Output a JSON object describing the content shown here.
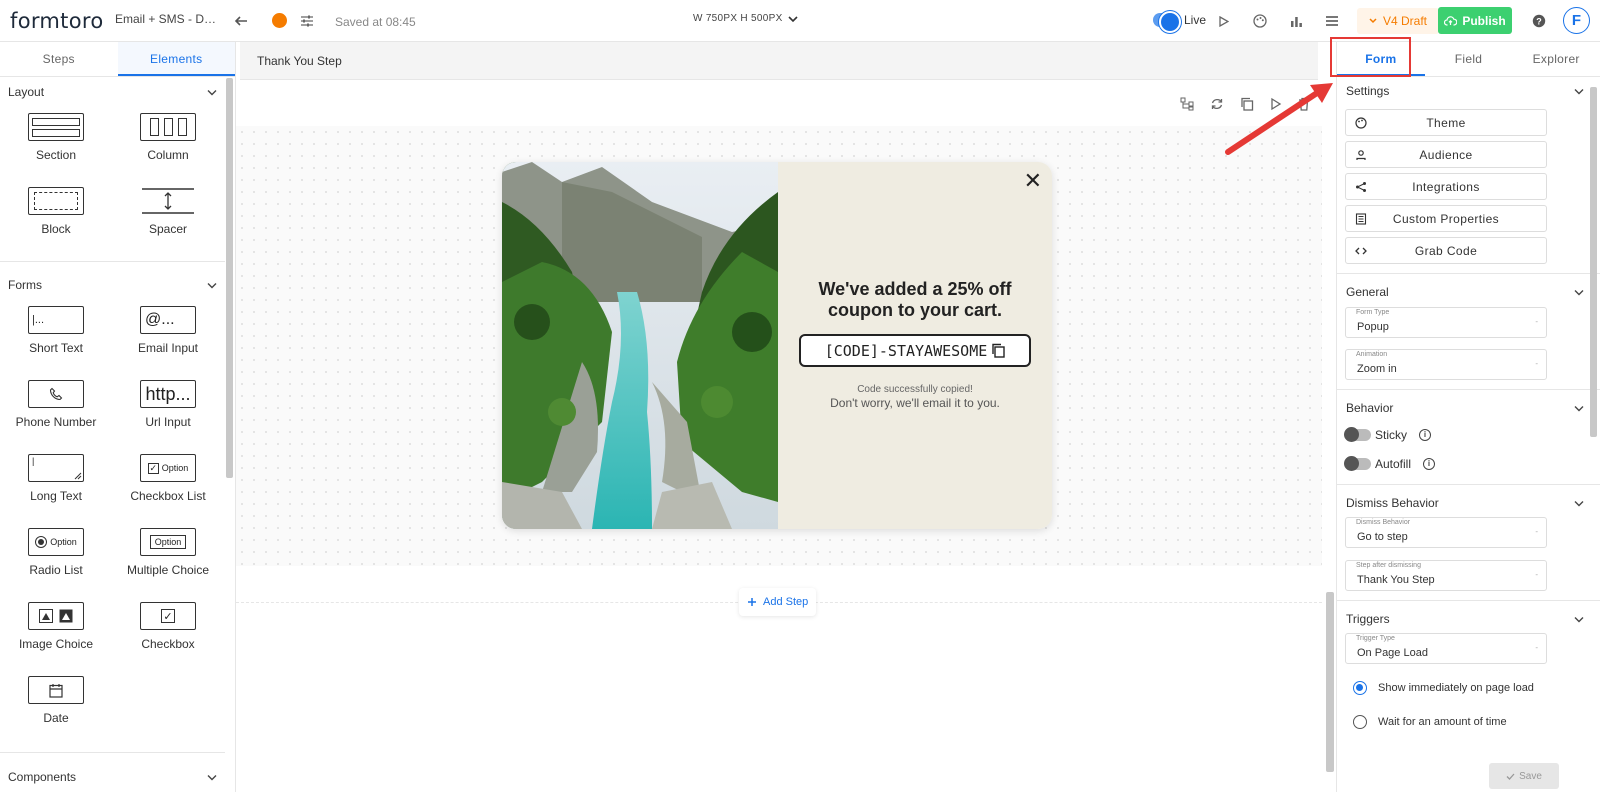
{
  "topbar": {
    "logo": "formtoro",
    "form_name": "Email + SMS - Des...",
    "saved_text": "Saved at 08:45",
    "dims": "W 750PX  H 500PX",
    "live_label": "Live",
    "draft_label": "V4 Draft",
    "publish_label": "Publish",
    "avatar_letter": "F"
  },
  "left_panel": {
    "tabs": [
      "Steps",
      "Elements"
    ],
    "active_tab": "Elements",
    "sections": {
      "layout": {
        "title": "Layout",
        "items": [
          "Section",
          "Column",
          "Block",
          "Spacer"
        ]
      },
      "forms": {
        "title": "Forms",
        "items": [
          "Short Text",
          "Email Input",
          "Phone Number",
          "Url Input",
          "Long Text",
          "Checkbox List",
          "Radio List",
          "Multiple Choice",
          "Image Choice",
          "Checkbox",
          "Date"
        ]
      },
      "components": {
        "title": "Components"
      }
    },
    "icon_text": {
      "short_text": "|...",
      "email": "@...",
      "url": "http...",
      "option": "Option"
    }
  },
  "canvas": {
    "step_name": "Thank You Step",
    "popup": {
      "headline": "We've added a 25% off coupon to your cart.",
      "code": "[CODE]-STAYAWESOME",
      "copied": "Code successfully copied!",
      "email_note": "Don't worry, we'll email it to you."
    },
    "add_step_label": "Add Step"
  },
  "right_panel": {
    "tabs": [
      "Form",
      "Field",
      "Explorer"
    ],
    "active_tab": "Form",
    "settings": {
      "title": "Settings",
      "buttons": [
        {
          "label": "Theme",
          "icon": "palette-icon"
        },
        {
          "label": "Audience",
          "icon": "person-icon"
        },
        {
          "label": "Integrations",
          "icon": "share-icon"
        },
        {
          "label": "Custom Properties",
          "icon": "list-icon"
        },
        {
          "label": "Grab Code",
          "icon": "code-icon"
        }
      ]
    },
    "general": {
      "title": "General",
      "form_type_label": "Form Type",
      "form_type_value": "Popup",
      "animation_label": "Animation",
      "animation_value": "Zoom in"
    },
    "behavior": {
      "title": "Behavior",
      "sticky_label": "Sticky",
      "autofill_label": "Autofill"
    },
    "dismiss": {
      "title": "Dismiss Behavior",
      "behavior_label": "Dismiss Behavior",
      "behavior_value": "Go to step",
      "step_label": "Step after dismissing",
      "step_value": "Thank You Step"
    },
    "triggers": {
      "title": "Triggers",
      "trigger_type_label": "Trigger Type",
      "trigger_type_value": "On Page Load",
      "options": [
        "Show immediately on page load",
        "Wait for an amount of time"
      ],
      "selected": 0
    },
    "save_label": "Save"
  },
  "colors": {
    "accent": "#1a73e8",
    "publish": "#3cd070",
    "draft": "#f57c00",
    "highlight": "#e53935",
    "popup_bg": "#efece1"
  }
}
